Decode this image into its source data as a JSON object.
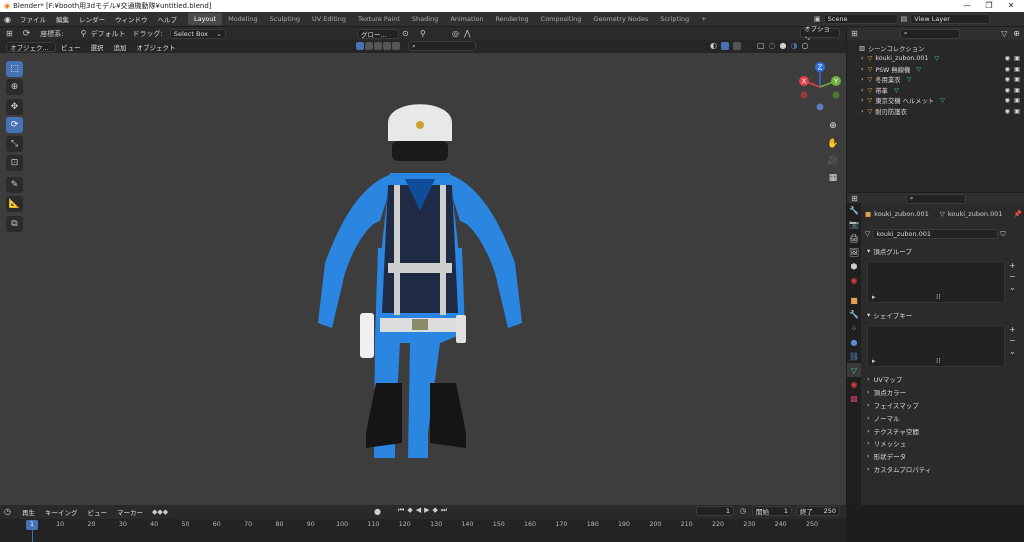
{
  "titlebar": {
    "title": "Blender* [F:¥booth用3dモデル¥交通機動隊¥untitled.blend]",
    "minimize": "—",
    "maximize": "❐",
    "close": "✕"
  },
  "menubar": {
    "menus": [
      "ファイル",
      "編集",
      "レンダー",
      "ウィンドウ",
      "ヘルプ"
    ],
    "workspaces": [
      "Layout",
      "Modeling",
      "Sculpting",
      "UV Editing",
      "Texture Paint",
      "Shading",
      "Animation",
      "Rendering",
      "Compositing",
      "Geometry Nodes",
      "Scripting"
    ],
    "add_tab": "+",
    "scene": "Scene",
    "view_layer": "View Layer"
  },
  "header": {
    "coord": "座標系:",
    "coord_value": "デフォルト",
    "drag": "ドラッグ:",
    "drag_value": "Select Box",
    "transform": "グロー...",
    "options": "オプション"
  },
  "header2": {
    "mode": "オブジェク...",
    "menus": [
      "ビュー",
      "選択",
      "追加",
      "オブジェクト"
    ]
  },
  "outliner": {
    "collection": "シーンコレクション",
    "items": [
      "kouki_zubon.001",
      "PSW 無線機",
      "冬用業衣",
      "帯革",
      "東京交機 ヘルメット",
      "耐刃防護衣"
    ]
  },
  "properties": {
    "object_name": "kouki_zubon.001",
    "mesh_name": "kouki_zubon.001",
    "data_field": "kouki_zubon.001",
    "panel_vertex_groups": "頂点グループ",
    "panel_shape_keys": "シェイプキー",
    "sections": [
      "UVマップ",
      "頂点カラー",
      "フェイスマップ",
      "ノーマル",
      "テクスチャ空間",
      "リメッシュ",
      "形状データ",
      "カスタムプロパティ"
    ]
  },
  "timeline": {
    "menus": [
      "再生",
      "キーイング",
      "ビュー",
      "マーカー"
    ],
    "current_frame": "1",
    "start_label": "開始",
    "start": "1",
    "end_label": "終了",
    "end": "250",
    "ticks": [
      "1",
      "10",
      "20",
      "30",
      "40",
      "50",
      "60",
      "70",
      "80",
      "90",
      "100",
      "110",
      "120",
      "130",
      "140",
      "150",
      "160",
      "170",
      "180",
      "190",
      "200",
      "210",
      "220",
      "230",
      "240",
      "250"
    ]
  },
  "gizmo": {
    "z": "Z",
    "y": "Y",
    "x": "X"
  },
  "colors": {
    "accent": "#4772b3",
    "uniform_blue": "#2a86e0",
    "vest": "#1f2a44",
    "helmet": "#e8e8e8"
  }
}
